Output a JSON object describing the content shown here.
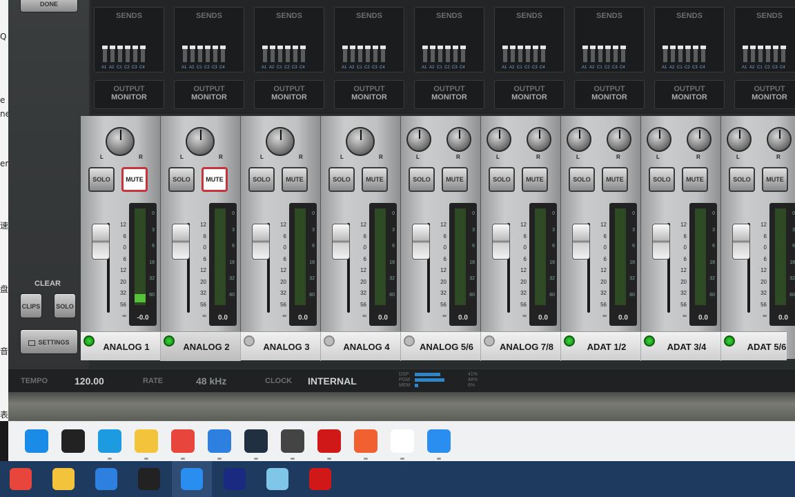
{
  "left_strip_chars": [
    "Q",
    "e",
    "ne",
    "er",
    "速",
    "盘",
    "音",
    "表"
  ],
  "side": {
    "done_label": "DONE",
    "clear_label": "CLEAR",
    "clips_label": "CLIPS",
    "solo_label": "SOLO",
    "settings_label": "SETTINGS"
  },
  "sends_title": "SENDS",
  "send_labels": [
    "A1",
    "A2",
    "C1",
    "C2",
    "C3",
    "C4"
  ],
  "output_line1": "OUTPUT",
  "output_line2": "MONITOR",
  "pan_left": "L",
  "pan_right": "R",
  "solo_label": "SOLO",
  "mute_label": "MUTE",
  "fader_scale": [
    "12",
    "6",
    "0",
    "6",
    "12",
    "20",
    "32",
    "56",
    "∞"
  ],
  "meter_scale": [
    "0",
    "3",
    "6",
    "18",
    "32",
    "60"
  ],
  "channels": [
    {
      "name": "ANALOG 1",
      "power": "on",
      "stereo": false,
      "mute_active": true,
      "meter_value": "-0.0",
      "meter_signal": 0.15
    },
    {
      "name": "ANALOG 2",
      "power": "on",
      "stereo": false,
      "mute_active": true,
      "meter_value": "0.0",
      "meter_signal": 0
    },
    {
      "name": "ANALOG 3",
      "power": "off",
      "stereo": false,
      "mute_active": false,
      "meter_value": "0.0",
      "meter_signal": 0
    },
    {
      "name": "ANALOG 4",
      "power": "off",
      "stereo": false,
      "mute_active": false,
      "meter_value": "0.0",
      "meter_signal": 0
    },
    {
      "name": "ANALOG 5/6",
      "power": "off",
      "stereo": true,
      "mute_active": false,
      "meter_value": "0.0",
      "meter_signal": 0
    },
    {
      "name": "ANALOG 7/8",
      "power": "off",
      "stereo": true,
      "mute_active": false,
      "meter_value": "0.0",
      "meter_signal": 0
    },
    {
      "name": "ADAT 1/2",
      "power": "on",
      "stereo": true,
      "mute_active": false,
      "meter_value": "0.0",
      "meter_signal": 0
    },
    {
      "name": "ADAT 3/4",
      "power": "on",
      "stereo": true,
      "mute_active": false,
      "meter_value": "0.0",
      "meter_signal": 0
    },
    {
      "name": "ADAT 5/6",
      "power": "on",
      "stereo": true,
      "mute_active": false,
      "meter_value": "0.0",
      "meter_signal": 0
    }
  ],
  "status": {
    "tempo_label": "TEMPO",
    "tempo_value": "120.00",
    "rate_label": "RATE",
    "rate_value": "48 kHz",
    "clock_label": "CLOCK",
    "clock_value": "INTERNAL",
    "dsp": [
      {
        "label": "DSP",
        "pct": "41%",
        "fraction": 0.41
      },
      {
        "label": "PGM",
        "pct": "48%",
        "fraction": 0.48
      },
      {
        "label": "MEM",
        "pct": "6%",
        "fraction": 0.06
      }
    ]
  },
  "taskbar_top": [
    {
      "icon": "windows-start-icon",
      "color": "#1a8ce8"
    },
    {
      "icon": "search-icon",
      "color": "#222222"
    },
    {
      "icon": "edge-icon",
      "color": "#1d9be0"
    },
    {
      "icon": "file-explorer-icon",
      "color": "#f3c33c"
    },
    {
      "icon": "chrome-icon",
      "color": "#e8453c"
    },
    {
      "icon": "k-app-icon",
      "color": "#2d7fe0"
    },
    {
      "icon": "dark-app-icon",
      "color": "#203040"
    },
    {
      "icon": "audio-app-icon",
      "color": "#444444"
    },
    {
      "icon": "record-icon",
      "color": "#d01818"
    },
    {
      "icon": "orange-app-icon",
      "color": "#f06030"
    },
    {
      "icon": "brand-app-icon",
      "color": "#ffffff"
    },
    {
      "icon": "blue-app-icon",
      "color": "#2a8ef0"
    }
  ],
  "taskbar_bottom": [
    {
      "icon": "chrome-icon",
      "color": "#e8453c"
    },
    {
      "icon": "file-explorer-icon",
      "color": "#f3c33c"
    },
    {
      "icon": "k-app-icon",
      "color": "#2d7fe0"
    },
    {
      "icon": "qq-penguin-icon",
      "color": "#222222"
    },
    {
      "icon": "blue-app-icon",
      "color": "#2a8ef0"
    },
    {
      "icon": "kx-app-icon",
      "color": "#1a2a80"
    },
    {
      "icon": "glass-app-icon",
      "color": "#7fc6e8"
    },
    {
      "icon": "record-icon",
      "color": "#d01818"
    }
  ]
}
